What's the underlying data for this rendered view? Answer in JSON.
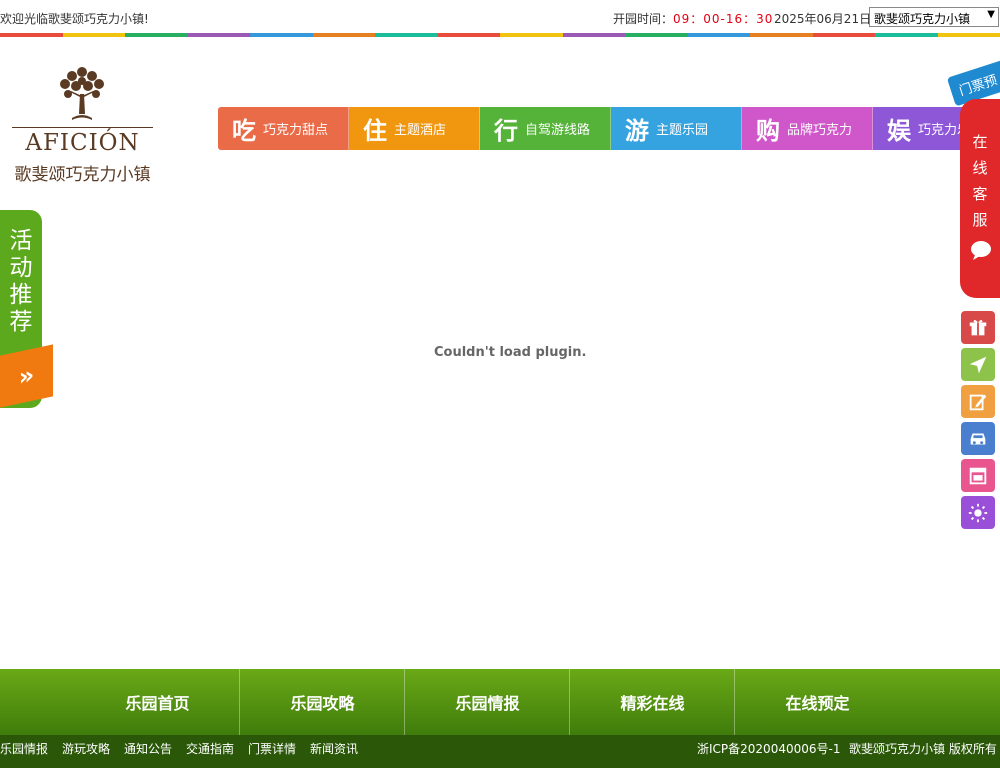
{
  "topbar": {
    "welcome": "欢迎光临歌斐颂巧克力小镇!",
    "hours_label": "开园时间：",
    "hours": "09：00-16：30",
    "date": "2025年06月21日",
    "select_value": "歌斐颂巧克力小镇"
  },
  "stripe_colors": [
    "#e84c3d",
    "#f1c40f",
    "#27ae60",
    "#9b59b6",
    "#3498db",
    "#e67e22",
    "#1abc9c",
    "#e84c3d",
    "#f1c40f",
    "#9b59b6",
    "#27ae60",
    "#3498db",
    "#e67e22",
    "#e84c3d",
    "#1abc9c",
    "#f1c40f"
  ],
  "logo": {
    "en": "AFICIÓN",
    "cn": "歌斐颂巧克力小镇"
  },
  "nav": [
    {
      "big": "吃",
      "small": "巧克力甜点",
      "color": "#ea6b48"
    },
    {
      "big": "住",
      "small": "主题酒店",
      "color": "#f0960f"
    },
    {
      "big": "行",
      "small": "自驾游线路",
      "color": "#56b33a"
    },
    {
      "big": "游",
      "small": "主题乐园",
      "color": "#34a3df"
    },
    {
      "big": "购",
      "small": "品牌巧克力",
      "color": "#cf57c9"
    },
    {
      "big": "娱",
      "small": "巧克力乐",
      "color": "#8d57d8"
    }
  ],
  "plugin_message": "Couldn't load plugin.",
  "promo": {
    "text": "活动推荐",
    "arrow": "»"
  },
  "ticket_tab": "门票预订",
  "service": {
    "text": "在线客服"
  },
  "side_buttons": [
    {
      "icon": "gift-icon",
      "color": "#d84a4a"
    },
    {
      "icon": "navigation-icon",
      "color": "#8ec34b"
    },
    {
      "icon": "edit-icon",
      "color": "#f0a040"
    },
    {
      "icon": "car-icon",
      "color": "#4a7fd0"
    },
    {
      "icon": "layout-icon",
      "color": "#e8558f"
    },
    {
      "icon": "sun-icon",
      "color": "#9a4fd8"
    }
  ],
  "bottom_nav": [
    "乐园首页",
    "乐园攻略",
    "乐园情报",
    "精彩在线",
    "在线预定"
  ],
  "footer": {
    "links": [
      "乐园情报",
      "游玩攻略",
      "通知公告",
      "交通指南",
      "门票详情",
      "新闻资讯"
    ],
    "icp": "浙ICP备2020040006号-1",
    "copyright": "歌斐颂巧克力小镇 版权所有"
  }
}
